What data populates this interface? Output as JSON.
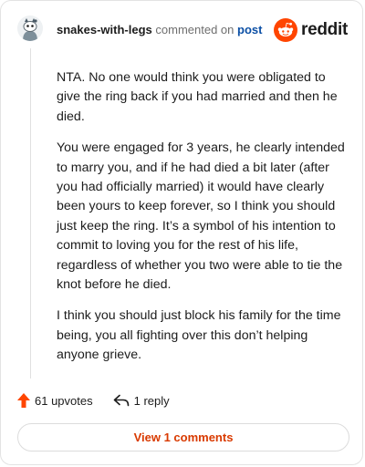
{
  "header": {
    "username": "snakes-with-legs",
    "commented_text": "commented on",
    "post_link": "post",
    "brand": "reddit"
  },
  "comment": {
    "paragraphs": [
      "NTA. No one would think you were obligated to give the ring back if you had married and then he died.",
      "You were engaged for 3 years, he clearly intended to marry you, and if he had died a bit later (after you had officially married) it would have clearly been yours to keep forever, so I think you should just keep the ring. It’s a symbol of his intention to commit to loving you for the rest of his life, regardless of whether you two were able to tie the knot before he died.",
      "I think you should just block his family for the time being, you all fighting over this don’t helping anyone grieve."
    ]
  },
  "actions": {
    "upvotes": "61 upvotes",
    "replies": "1 reply",
    "view_comments": "View 1 comments"
  },
  "icons": {
    "upvote": "upvote-arrow-icon",
    "reply": "reply-arrow-icon",
    "avatar": "snoo-avatar",
    "logo": "reddit-snoo-logo"
  },
  "colors": {
    "accent": "#ff4500",
    "link": "#0b4fa5",
    "view_button_text": "#d93a00"
  }
}
